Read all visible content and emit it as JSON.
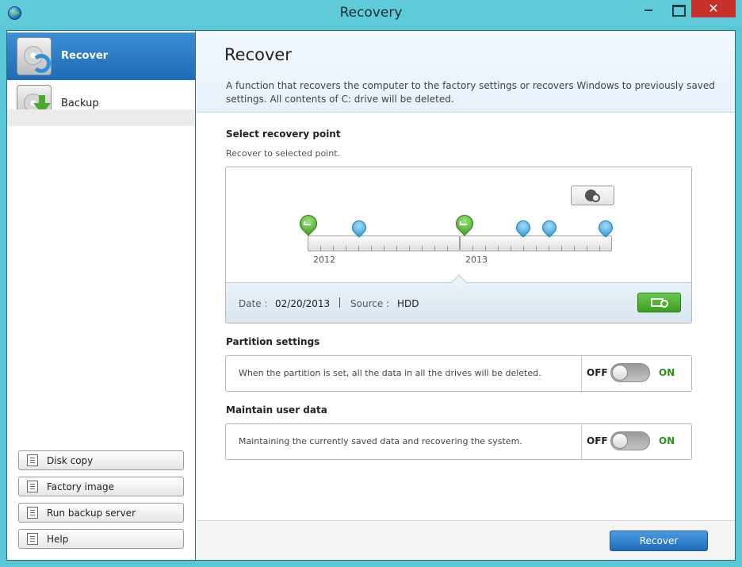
{
  "window": {
    "title": "Recovery",
    "close_glyph": "✕"
  },
  "sidebar": {
    "items": [
      {
        "label": "Recover",
        "icon": "hdd-recover-icon",
        "selected": true
      },
      {
        "label": "Backup",
        "icon": "hdd-backup-icon",
        "selected": false
      }
    ],
    "buttons": [
      {
        "label": "Disk copy",
        "icon": "disk-copy-icon"
      },
      {
        "label": "Factory image",
        "icon": "factory-image-icon"
      },
      {
        "label": "Run backup server",
        "icon": "backup-server-icon"
      },
      {
        "label": "Help",
        "icon": "help-icon"
      }
    ]
  },
  "main": {
    "title": "Recover",
    "description": "A function that recovers the computer to the factory settings or recovers Windows to previously saved settings. All contents of C: drive will be deleted.",
    "recovery_point": {
      "heading": "Select recovery point",
      "subheading": "Recover to selected point.",
      "years": [
        "2012",
        "2013"
      ],
      "date_label": "Date :",
      "date_value": "02/20/2013",
      "source_label": "Source :",
      "source_value": "HDD"
    },
    "partition": {
      "heading": "Partition settings",
      "text": "When the partition is set, all the data in all the drives will be deleted.",
      "off_label": "OFF",
      "on_label": "ON",
      "state": "off"
    },
    "user_data": {
      "heading": "Maintain user data",
      "text": "Maintaining the currently saved data and recovering the system.",
      "off_label": "OFF",
      "on_label": "ON",
      "state": "off"
    },
    "recover_button": "Recover"
  },
  "colors": {
    "titlebar": "#5fcbd9",
    "selected_nav": "#2b7cc9",
    "close_button": "#c9302c",
    "on_green": "#2f8f1a",
    "primary_button": "#2f7fcf"
  }
}
